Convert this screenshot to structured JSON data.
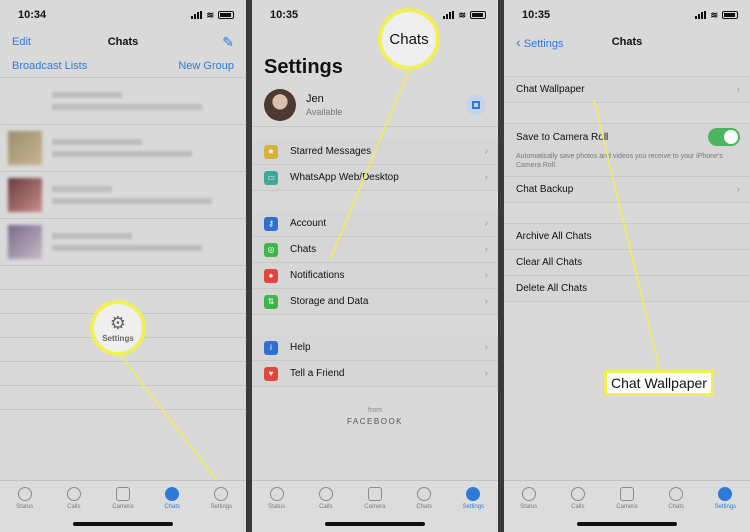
{
  "panel1": {
    "time": "10:34",
    "nav": {
      "edit": "Edit",
      "title": "Chats"
    },
    "links": {
      "broadcast": "Broadcast Lists",
      "new_group": "New Group"
    },
    "callout": "Settings",
    "tabs": [
      "Status",
      "Calls",
      "Camera",
      "Chats",
      "Settings"
    ]
  },
  "panel2": {
    "time": "10:35",
    "callout": "Chats",
    "title": "Settings",
    "profile": {
      "name": "Jen",
      "status": "Available"
    },
    "group1": [
      "Starred Messages",
      "WhatsApp Web/Desktop"
    ],
    "group2": [
      "Account",
      "Chats",
      "Notifications",
      "Storage and Data"
    ],
    "group3": [
      "Help",
      "Tell a Friend"
    ],
    "footer": {
      "from": "from",
      "brand": "FACEBOOK"
    },
    "tabs": [
      "Status",
      "Calls",
      "Camera",
      "Chats",
      "Settings"
    ]
  },
  "panel3": {
    "time": "10:35",
    "nav": {
      "back": "Settings",
      "title": "Chats"
    },
    "wallpaper": "Chat Wallpaper",
    "save_camera_roll": "Save to Camera Roll",
    "save_note": "Automatically save photos and videos you receive to your iPhone's Camera Roll.",
    "backup": "Chat Backup",
    "archive": "Archive All Chats",
    "clear": "Clear All Chats",
    "delete": "Delete All Chats",
    "callout": "Chat Wallpaper",
    "tabs": [
      "Status",
      "Calls",
      "Camera",
      "Chats",
      "Settings"
    ]
  },
  "colors": {
    "accent": "#2f7ad8",
    "destructive": "#e2453c",
    "highlight": "#f1ef57",
    "toggle_on": "#4cb560"
  }
}
